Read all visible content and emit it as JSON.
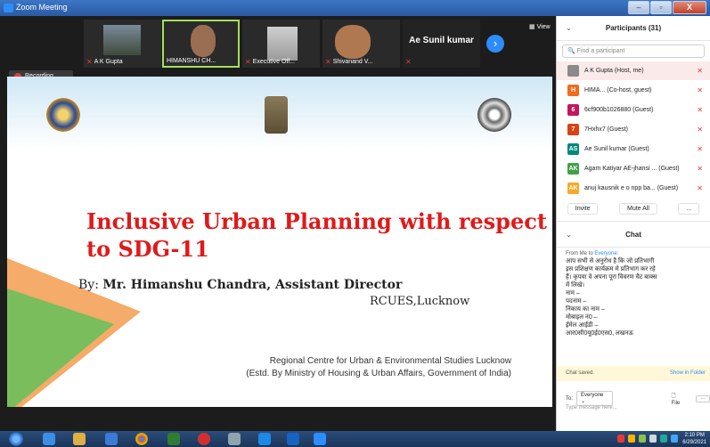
{
  "window": {
    "title": "Zoom Meeting",
    "min_label": "–",
    "max_label": "▫",
    "close_label": "X"
  },
  "gallery": {
    "participants": [
      {
        "name": "A K Gupta"
      },
      {
        "name": "HIMANSHU CH..."
      },
      {
        "name": "Executive Off..."
      },
      {
        "name": "Shivanand V..."
      },
      {
        "name": "Ae Sunil kumar"
      }
    ],
    "view_label": "View",
    "recording_label": "Recording..."
  },
  "slide": {
    "title": "Inclusive Urban Planning with respect to SDG-11",
    "by_prefix": "By: ",
    "presenter": "Mr. Himanshu Chandra, Assistant Director",
    "org": "RCUES,Lucknow",
    "footer1": "Regional Centre for Urban & Environmental Studies Lucknow",
    "footer2": "(Estd. By Ministry of Housing & Urban Affairs, Government of India)"
  },
  "participants_panel": {
    "header": "Participants (31)",
    "search_placeholder": "Find a participant",
    "rows": [
      {
        "avatar": "",
        "name": "A K Gupta (Host, me)",
        "color": "#8a8a8a"
      },
      {
        "avatar": "H",
        "name": "HIMA... (Co-host, guest)",
        "color": "#f26b1d"
      },
      {
        "avatar": "6",
        "name": "6cf900b1026880 (Guest)",
        "color": "#c2185b"
      },
      {
        "avatar": "7",
        "name": "7Hxhx7 (Guest)",
        "color": "#d84315"
      },
      {
        "avatar": "AS",
        "name": "Ae Sunil kumar (Guest)",
        "color": "#00897b"
      },
      {
        "avatar": "AK",
        "name": "Agam Katiyar AE-jhansi ... (Guest)",
        "color": "#43a047"
      },
      {
        "avatar": "AK",
        "name": "anuj kausnik e o npp ba... (Guest)",
        "color": "#f9a825"
      }
    ],
    "invite_label": "Invite",
    "mute_all_label": "Mute All",
    "more_label": "..."
  },
  "chat": {
    "header": "Chat",
    "from": "From Me to ",
    "to": "Everyone:",
    "message": "आप सभी से अनुरोध है कि जो प्रतिभागी\nइस प्रशिक्षण कार्यक्रम मे प्रतिभाग कर रहे\nहैं। कृपया वे अपना पूरा विवरण चैट बाक्स\nमें लिखे।\nनाम –\nपदनाम –\nनिकाय का नाम –\nमोबाइल नं0 –\nईमेल आईडी –\nआर0सी0यू0ई0एस0, लखनऊ",
    "saved_label": "Chat saved.",
    "show_folder_label": "Show in Folder",
    "to_label": "To:",
    "to_value": "Everyone",
    "file_label": "File",
    "more_label": "···",
    "input_placeholder": "Type message here..."
  },
  "taskbar": {
    "time": "2:10 PM",
    "date": "6/29/2021"
  }
}
